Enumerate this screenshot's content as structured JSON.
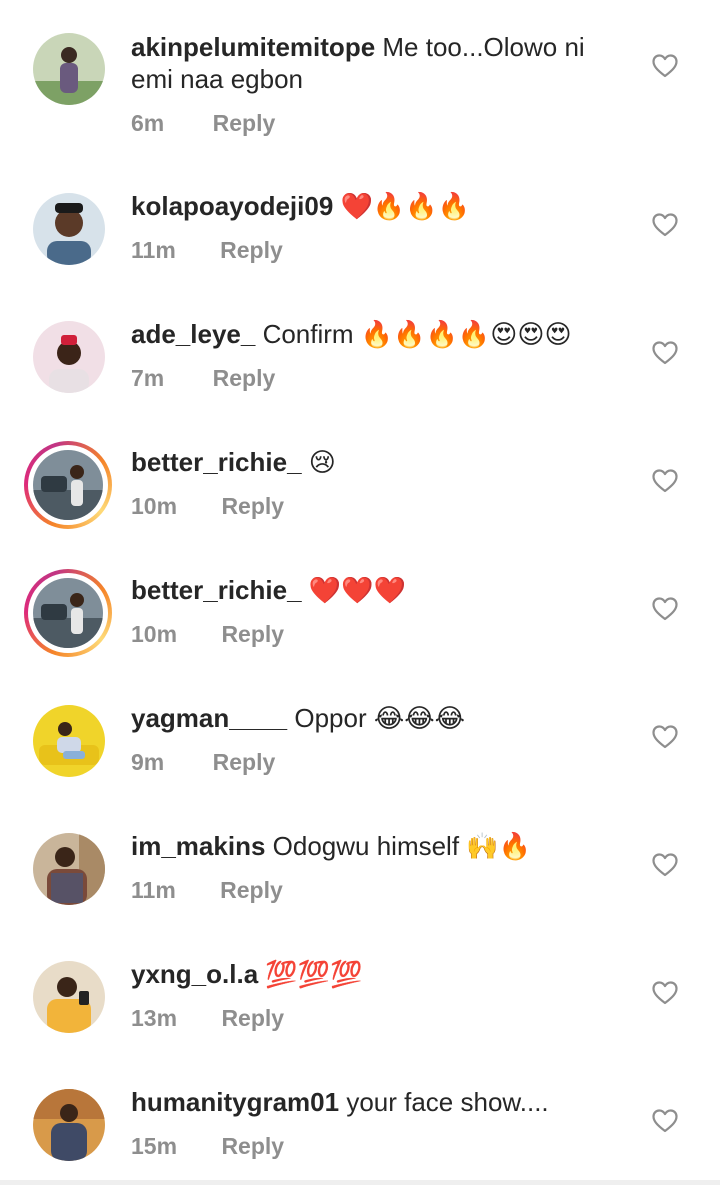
{
  "comments": [
    {
      "username": "akinpelumitemitope",
      "text": "Me too...Olowo ni emi naa egbon",
      "time": "6m",
      "reply_label": "Reply",
      "story_ring": false,
      "avatar_bg": "#c9d6b8"
    },
    {
      "username": "kolapoayodeji09",
      "text": "❤️🔥🔥🔥",
      "time": "11m",
      "reply_label": "Reply",
      "story_ring": false,
      "avatar_bg": "#d7e2ea"
    },
    {
      "username": "ade_leye_",
      "text": "Confirm 🔥🔥🔥🔥😍😍😍",
      "time": "7m",
      "reply_label": "Reply",
      "story_ring": false,
      "avatar_bg": "#f1dfe6"
    },
    {
      "username": "better_richie_",
      "text": "😢",
      "time": "10m",
      "reply_label": "Reply",
      "story_ring": true,
      "avatar_bg": "#7f8e99"
    },
    {
      "username": "better_richie_",
      "text": "❤️❤️❤️",
      "time": "10m",
      "reply_label": "Reply",
      "story_ring": true,
      "avatar_bg": "#7f8e99"
    },
    {
      "username": "yagman____",
      "text": "Oppor 😂😂😂",
      "time": "9m",
      "reply_label": "Reply",
      "story_ring": false,
      "avatar_bg": "#f0d42a"
    },
    {
      "username": "im_makins",
      "text": "Odogwu himself 🙌🔥",
      "time": "11m",
      "reply_label": "Reply",
      "story_ring": false,
      "avatar_bg": "#c9b59a"
    },
    {
      "username": "yxng_o.l.a",
      "text": "💯💯💯",
      "time": "13m",
      "reply_label": "Reply",
      "story_ring": false,
      "avatar_bg": "#f2b43a"
    },
    {
      "username": "humanitygram01",
      "text": "your face show....",
      "time": "15m",
      "reply_label": "Reply",
      "story_ring": false,
      "avatar_bg": "#d89a4a"
    }
  ],
  "colors": {
    "text": "#262626",
    "meta": "#8e8e8e",
    "heart_outline": "#8e8e8e"
  },
  "icons": {
    "like": "heart-outline-icon"
  }
}
